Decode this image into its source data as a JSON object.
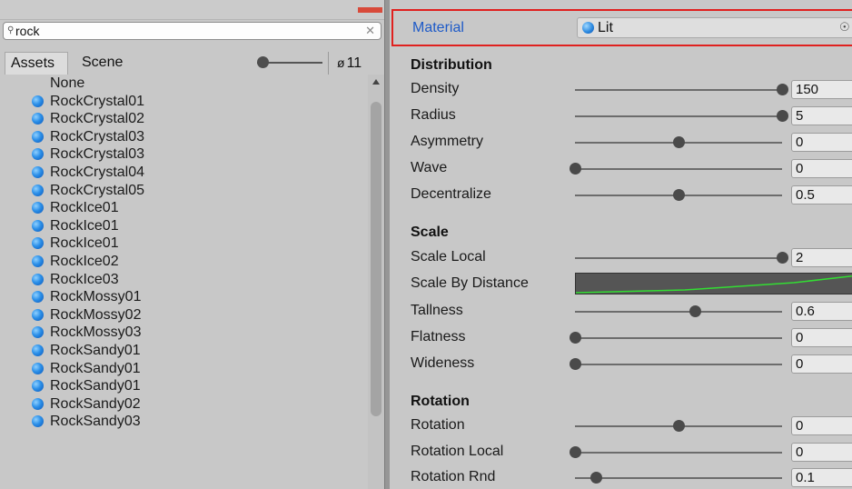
{
  "picker": {
    "search_value": "rock",
    "search_icon": "search-icon",
    "tabs": [
      {
        "label": "Assets",
        "active": true
      },
      {
        "label": "Scene",
        "active": false
      }
    ],
    "hidden_count": "11",
    "items": [
      {
        "label": "None",
        "icon": false
      },
      {
        "label": "RockCrystal01",
        "icon": true
      },
      {
        "label": "RockCrystal02",
        "icon": true
      },
      {
        "label": "RockCrystal03",
        "icon": true
      },
      {
        "label": "RockCrystal03",
        "icon": true
      },
      {
        "label": "RockCrystal04",
        "icon": true
      },
      {
        "label": "RockCrystal05",
        "icon": true
      },
      {
        "label": "RockIce01",
        "icon": true
      },
      {
        "label": "RockIce01",
        "icon": true
      },
      {
        "label": "RockIce01",
        "icon": true
      },
      {
        "label": "RockIce02",
        "icon": true
      },
      {
        "label": "RockIce03",
        "icon": true
      },
      {
        "label": "RockMossy01",
        "icon": true
      },
      {
        "label": "RockMossy02",
        "icon": true
      },
      {
        "label": "RockMossy03",
        "icon": true
      },
      {
        "label": "RockSandy01",
        "icon": true
      },
      {
        "label": "RockSandy01",
        "icon": true
      },
      {
        "label": "RockSandy01",
        "icon": true
      },
      {
        "label": "RockSandy02",
        "icon": true
      },
      {
        "label": "RockSandy03",
        "icon": true
      }
    ]
  },
  "inspector": {
    "material": {
      "label": "Material",
      "value": "Lit"
    },
    "distribution": {
      "title": "Distribution",
      "density": {
        "label": "Density",
        "value": "150",
        "slider": 1.0
      },
      "radius": {
        "label": "Radius",
        "value": "5",
        "slider": 1.0
      },
      "asymmetry": {
        "label": "Asymmetry",
        "value": "0",
        "slider": 0.5
      },
      "wave": {
        "label": "Wave",
        "value": "0",
        "slider": 0.0
      },
      "decentralize": {
        "label": "Decentralize",
        "value": "0.5",
        "slider": 0.5
      }
    },
    "scale": {
      "title": "Scale",
      "scale_local": {
        "label": "Scale Local",
        "value": "2",
        "slider": 1.0
      },
      "scale_by_distance": {
        "label": "Scale By Distance"
      },
      "tallness": {
        "label": "Tallness",
        "value": "0.6",
        "slider": 0.58
      },
      "flatness": {
        "label": "Flatness",
        "value": "0",
        "slider": 0.0
      },
      "wideness": {
        "label": "Wideness",
        "value": "0",
        "slider": 0.0
      }
    },
    "rotation": {
      "title": "Rotation",
      "rotation": {
        "label": "Rotation",
        "value": "0",
        "slider": 0.5
      },
      "rotation_local": {
        "label": "Rotation Local",
        "value": "0",
        "slider": 0.0
      },
      "rotation_rnd": {
        "label": "Rotation Rnd",
        "value": "0.1",
        "slider": 0.1
      }
    },
    "colors": {
      "highlight": "#e0211f",
      "curve": "#33dd33",
      "material_label": "#1d5ac8"
    }
  }
}
